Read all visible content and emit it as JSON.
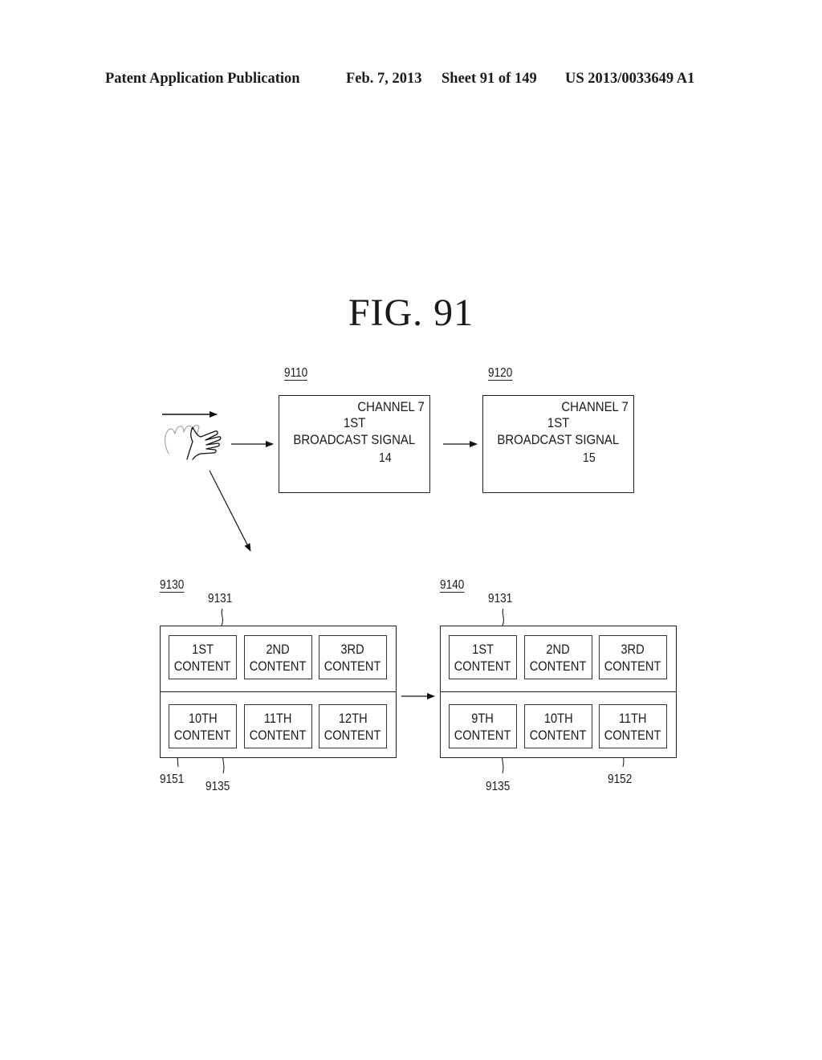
{
  "header": {
    "publication": "Patent Application Publication",
    "date": "Feb. 7, 2013",
    "sheet": "Sheet 91 of 149",
    "patent_number": "US 2013/0033649 A1"
  },
  "figure": {
    "title": "FIG.  91"
  },
  "gesture": {
    "icon": "hand-swipe-right-icon",
    "direction": "right"
  },
  "screens": [
    {
      "ref": "9110",
      "channel": "CHANNEL 7",
      "line1": "1ST",
      "line2": "BROADCAST SIGNAL",
      "volume_value": "14",
      "volume_icon": "volume-bar-icon"
    },
    {
      "ref": "9120",
      "channel": "CHANNEL 7",
      "line1": "1ST",
      "line2": "BROADCAST SIGNAL",
      "volume_value": "15",
      "volume_icon": "volume-bar-icon"
    }
  ],
  "grids": [
    {
      "ref": "9130",
      "top_row_ref": "9131",
      "bottom_row_ref": "9135",
      "highlight_ref": "9151",
      "top_row": [
        {
          "l1": "1ST",
          "l2": "CONTENT"
        },
        {
          "l1": "2ND",
          "l2": "CONTENT"
        },
        {
          "l1": "3RD",
          "l2": "CONTENT"
        }
      ],
      "bottom_row": [
        {
          "l1": "10TH",
          "l2": "CONTENT"
        },
        {
          "l1": "11TH",
          "l2": "CONTENT"
        },
        {
          "l1": "12TH",
          "l2": "CONTENT"
        }
      ]
    },
    {
      "ref": "9140",
      "top_row_ref": "9131",
      "bottom_row_ref": "9135",
      "highlight_ref": "9152",
      "top_row": [
        {
          "l1": "1ST",
          "l2": "CONTENT"
        },
        {
          "l1": "2ND",
          "l2": "CONTENT"
        },
        {
          "l1": "3RD",
          "l2": "CONTENT"
        }
      ],
      "bottom_row": [
        {
          "l1": "9TH",
          "l2": "CONTENT"
        },
        {
          "l1": "10TH",
          "l2": "CONTENT"
        },
        {
          "l1": "11TH",
          "l2": "CONTENT"
        }
      ]
    }
  ]
}
